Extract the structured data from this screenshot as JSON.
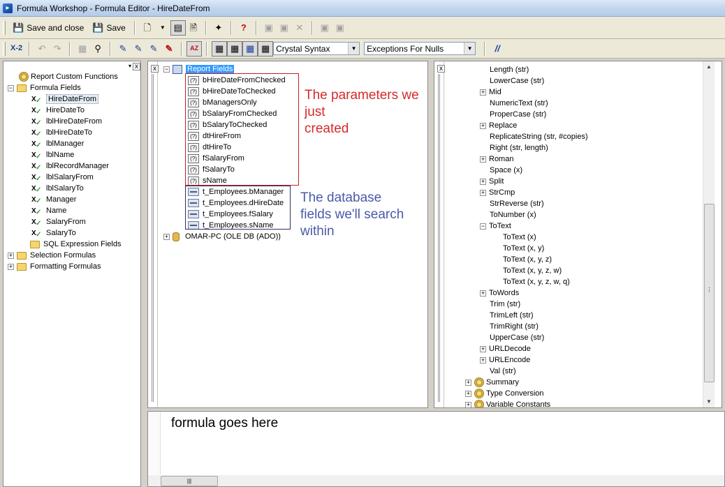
{
  "window": {
    "title": "Formula Workshop - Formula Editor - HireDateFrom"
  },
  "toolbar1": {
    "save_close_label": "Save and close",
    "save_label": "Save"
  },
  "toolbar2": {
    "syntax": "Crystal Syntax",
    "nulls": "Exceptions For Nulls",
    "comment_label": "//",
    "check_label": "X-2",
    "az_label": "AZ"
  },
  "workshop_tree": {
    "items": [
      "Report Custom Functions",
      "Formula Fields",
      "HireDateFrom",
      "HireDateTo",
      "lblHireDateFrom",
      "lblHireDateTo",
      "lblManager",
      "lblName",
      "lblRecordManager",
      "lblSalaryFrom",
      "lblSalaryTo",
      "Manager",
      "Name",
      "SalaryFrom",
      "SalaryTo",
      "SQL Expression Fields",
      "Selection Formulas",
      "Formatting Formulas"
    ]
  },
  "fields_tree": {
    "root": "Report Fields",
    "param_tag": "(?)",
    "params": [
      "bHireDateFromChecked",
      "bHireDateToChecked",
      "bManagersOnly",
      "bSalaryFromChecked",
      "bSalaryToChecked",
      "dtHireFrom",
      "dtHireTo",
      "fSalaryFrom",
      "fSalaryTo",
      "sName"
    ],
    "db_fields": [
      "t_Employees.bManager",
      "t_Employees.dHireDate",
      "t_Employees.fSalary",
      "t_Employees.sName"
    ],
    "datasource": "OMAR-PC (OLE DB (ADO))"
  },
  "annotations": {
    "params_line1": "The parameters we just",
    "params_line2": "created",
    "db_line1": "The database",
    "db_line2": "fields we'll search",
    "db_line3": "within"
  },
  "functions_tree": {
    "items": [
      "Length (str)",
      "LowerCase (str)",
      "Mid",
      "NumericText (str)",
      "ProperCase (str)",
      "Replace",
      "ReplicateString (str, #copies)",
      "Right (str, length)",
      "Roman",
      "Space (x)",
      "Split",
      "StrCmp",
      "StrReverse (str)",
      "ToNumber (x)",
      "ToText",
      "ToText (x)",
      "ToText (x, y)",
      "ToText (x, y, z)",
      "ToText (x, y, z, w)",
      "ToText (x, y, z, w, q)",
      "ToWords",
      "Trim (str)",
      "TrimLeft (str)",
      "TrimRight (str)",
      "UpperCase (str)",
      "URLDecode",
      "URLEncode",
      "Val (str)",
      "Summary",
      "Type Conversion",
      "Variable Constants"
    ]
  },
  "editor": {
    "text": "formula goes here"
  },
  "colors": {
    "annotation_red": "#d42a2a",
    "annotation_blue": "#4a5aa8",
    "selection": "#3399ff"
  },
  "icons": {
    "glyphs": {
      "save": "💾",
      "new": "🗋",
      "dropdown": "▼",
      "fields": "▤",
      "properties": "🗎",
      "wand": "✦",
      "help": "?",
      "tool": "▣",
      "close": "✕",
      "undo": "↶",
      "redo": "↷",
      "monitor": "▦",
      "find": "⚲",
      "bookmark": "✎",
      "toggle": "▦",
      "scroll_up": "▲",
      "scroll_down": "▼",
      "scroll_thumb": "⋮",
      "hgrip": "|||",
      "collapse": "−",
      "expand": "+",
      "close_small": "x",
      "dropdown_small": "▾"
    }
  }
}
